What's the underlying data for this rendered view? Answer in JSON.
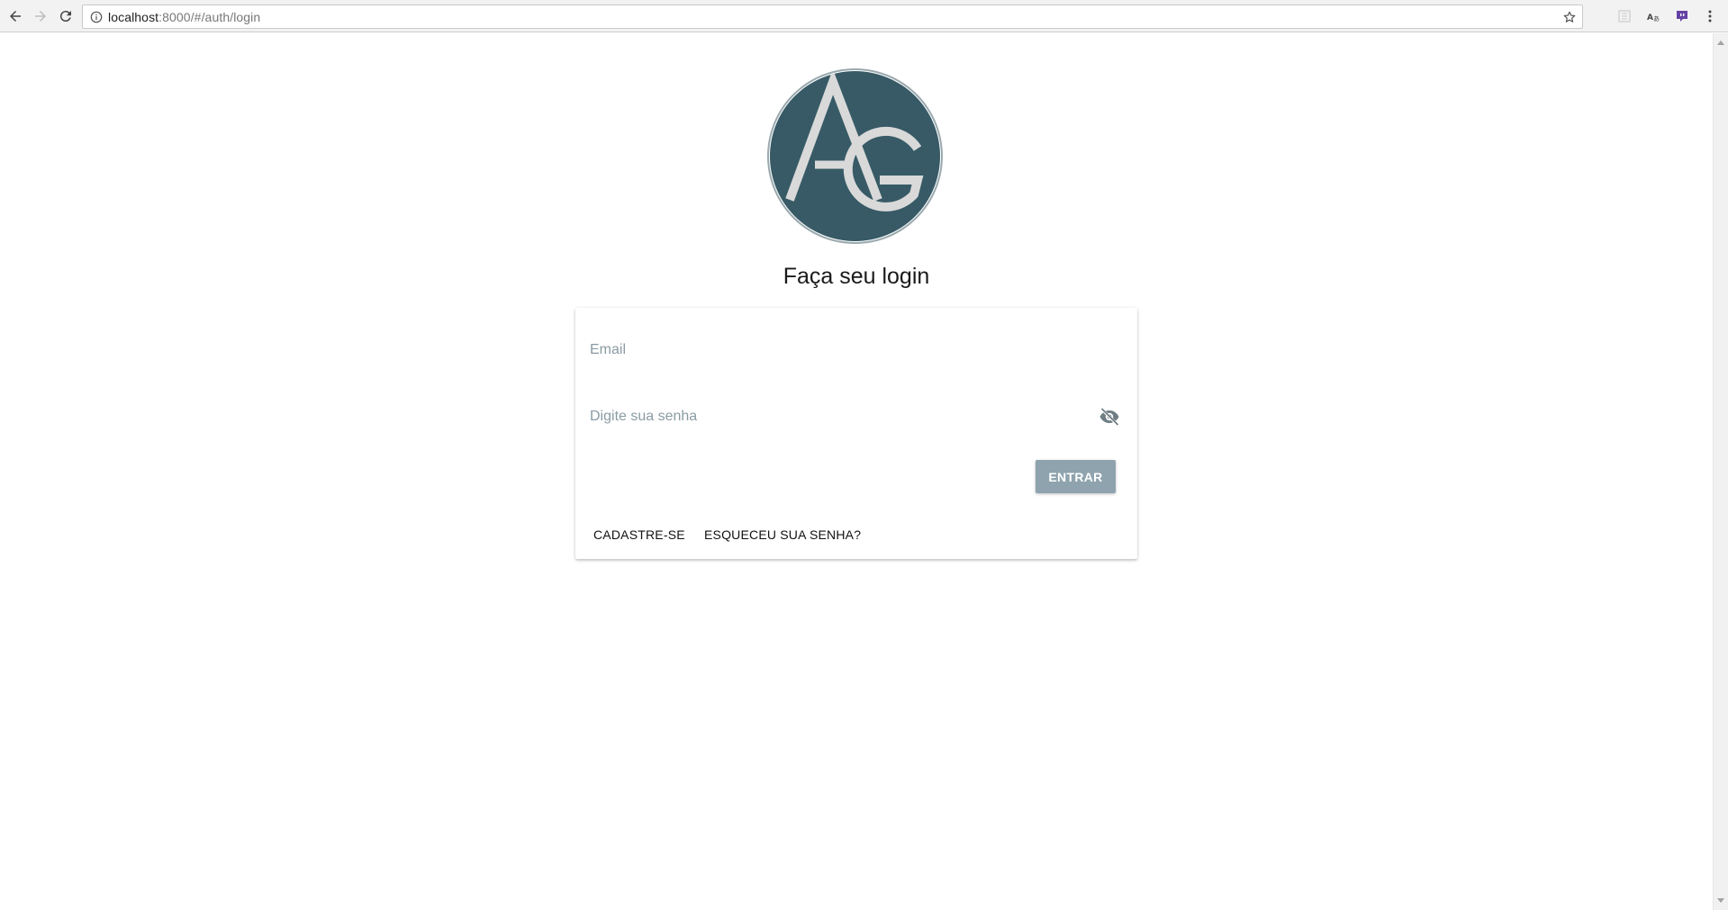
{
  "browser": {
    "url_host": "localhost",
    "url_rest": ":8000/#/auth/login"
  },
  "login": {
    "logo_letters": "AG",
    "title": "Faça seu login",
    "email_placeholder": "Email",
    "password_placeholder": "Digite sua senha",
    "submit_label": "ENTRAR",
    "signup_label": "CADASTRE-SE",
    "forgot_label": "ESQUECEU SUA SENHA?"
  },
  "colors": {
    "logo_background": "#375a66",
    "logo_letters": "#d9d9d9",
    "button_background": "#8ea3ad",
    "placeholder": "#8a9ba3"
  },
  "icons": {
    "back": "back-arrow-icon",
    "forward": "forward-arrow-icon",
    "reload": "reload-icon",
    "site_info": "info-icon",
    "bookmark": "star-icon",
    "password_toggle": "eye-off-icon"
  }
}
